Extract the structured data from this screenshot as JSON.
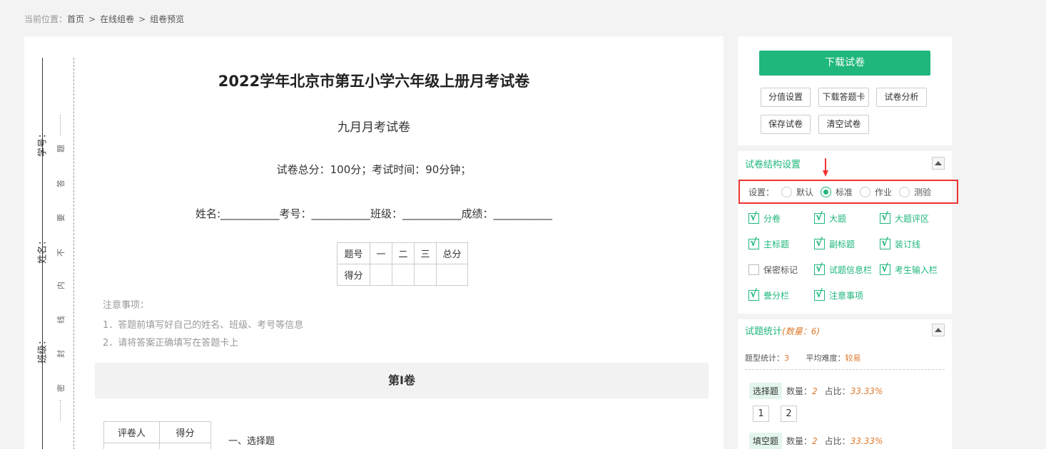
{
  "breadcrumb": {
    "label": "当前位置：",
    "items": [
      "首页",
      "在线组卷",
      "组卷预览"
    ],
    "separator": ">"
  },
  "binding": {
    "fields": [
      "学号：",
      "姓名：",
      "班级："
    ],
    "chars": [
      "题",
      "答",
      "要",
      "不",
      "内",
      "线",
      "封",
      "密"
    ]
  },
  "paper": {
    "title": "2022学年北京市第五小学六年级上册月考试卷",
    "subtitle": "九月月考试卷",
    "exam_info": "试卷总分：100分；考试时间：90分钟；",
    "student_info": "姓名:___________考号：___________班级：___________成绩：___________",
    "score_table": {
      "header": [
        "题号",
        "一",
        "二",
        "三",
        "总分"
      ],
      "row_label": "得分"
    },
    "notice_title": "注意事项：",
    "notices": [
      "1．答题前填写好自己的姓名、班级、考号等信息",
      "2．请将答案正确填写在答题卡上"
    ],
    "section_title": "第I卷",
    "grader_table": [
      "评卷人",
      "得分"
    ],
    "question_section": "一、选择题"
  },
  "actions": {
    "download": "下载试卷",
    "buttons": [
      "分值设置",
      "下载答题卡",
      "试卷分析",
      "保存试卷",
      "清空试卷"
    ]
  },
  "structure": {
    "title": "试卷结构设置",
    "setting_label": "设置：",
    "modes": [
      {
        "label": "默认",
        "selected": false
      },
      {
        "label": "标准",
        "selected": true
      },
      {
        "label": "作业",
        "selected": false
      },
      {
        "label": "测验",
        "selected": false
      }
    ],
    "options": [
      {
        "label": "分卷",
        "checked": true
      },
      {
        "label": "大题",
        "checked": true
      },
      {
        "label": "大题评区",
        "checked": true
      },
      {
        "label": "主标题",
        "checked": true
      },
      {
        "label": "副标题",
        "checked": true
      },
      {
        "label": "装订线",
        "checked": true
      },
      {
        "label": "保密标记",
        "checked": false
      },
      {
        "label": "试题信息栏",
        "checked": true
      },
      {
        "label": "考生输入栏",
        "checked": true
      },
      {
        "label": "誊分栏",
        "checked": true
      },
      {
        "label": "注意事项",
        "checked": true
      }
    ]
  },
  "stats": {
    "title": "试题统计",
    "count_label": "(数量：6)",
    "type_count_label": "题型统计：",
    "type_count": "3",
    "difficulty_label": "平均难度：",
    "difficulty": "较易",
    "qtypes": [
      {
        "name": "选择题",
        "count_label": "数量：",
        "count": "2",
        "ratio_label": "占比：",
        "ratio": "33.33%"
      },
      {
        "name": "填空题",
        "count_label": "数量：",
        "count": "2",
        "ratio_label": "占比：",
        "ratio": "33.33%"
      }
    ],
    "question_numbers": [
      "1",
      "2"
    ]
  },
  "colors": {
    "accent": "#1fb77b",
    "highlight": "#e33333",
    "orange": "#e07a2e"
  }
}
